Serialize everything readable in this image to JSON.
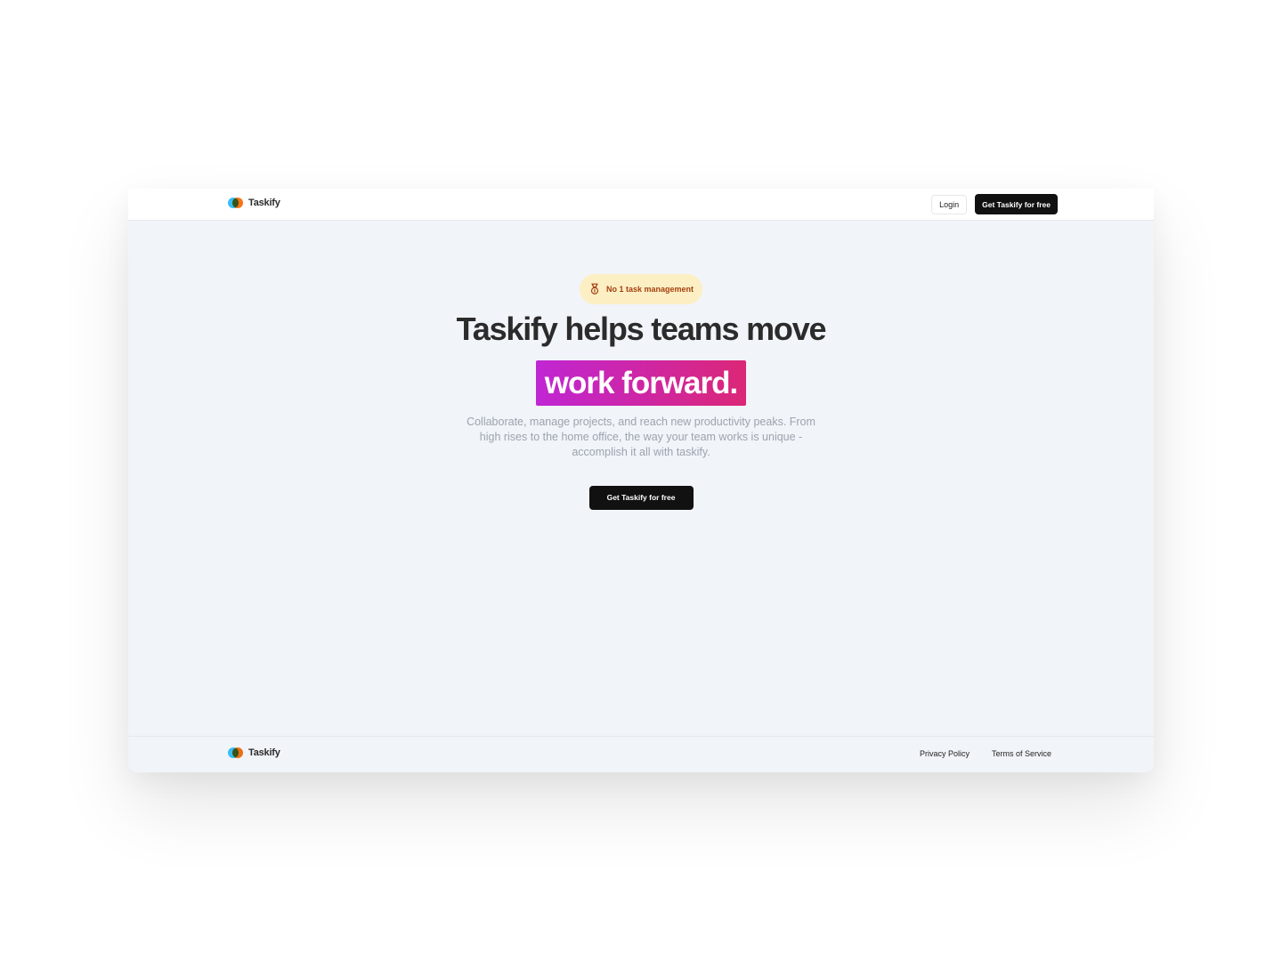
{
  "brand": {
    "name": "Taskify"
  },
  "nav": {
    "login_label": "Login",
    "cta_label": "Get Taskify for free"
  },
  "hero": {
    "badge_text": "No 1 task management",
    "headline": "Taskify helps teams move",
    "highlight": "work forward.",
    "subtitle": "Collaborate, manage projects, and reach new productivity peaks. From high rises to the home office, the way your team works is unique - accomplish it all with taskify.",
    "cta_label": "Get Taskify for free"
  },
  "footer": {
    "brand_name": "Taskify",
    "links": [
      {
        "label": "Privacy Policy"
      },
      {
        "label": "Terms of Service"
      }
    ]
  },
  "colors": {
    "badge_bg": "#fdefc4",
    "badge_text": "#a4400f",
    "highlight_start": "#c026d3",
    "highlight_end": "#db2777",
    "dark_button": "#111111",
    "page_bg": "#f1f4f8"
  },
  "icons": {
    "logo": "two-circle-logo-icon",
    "badge": "medal-icon"
  }
}
